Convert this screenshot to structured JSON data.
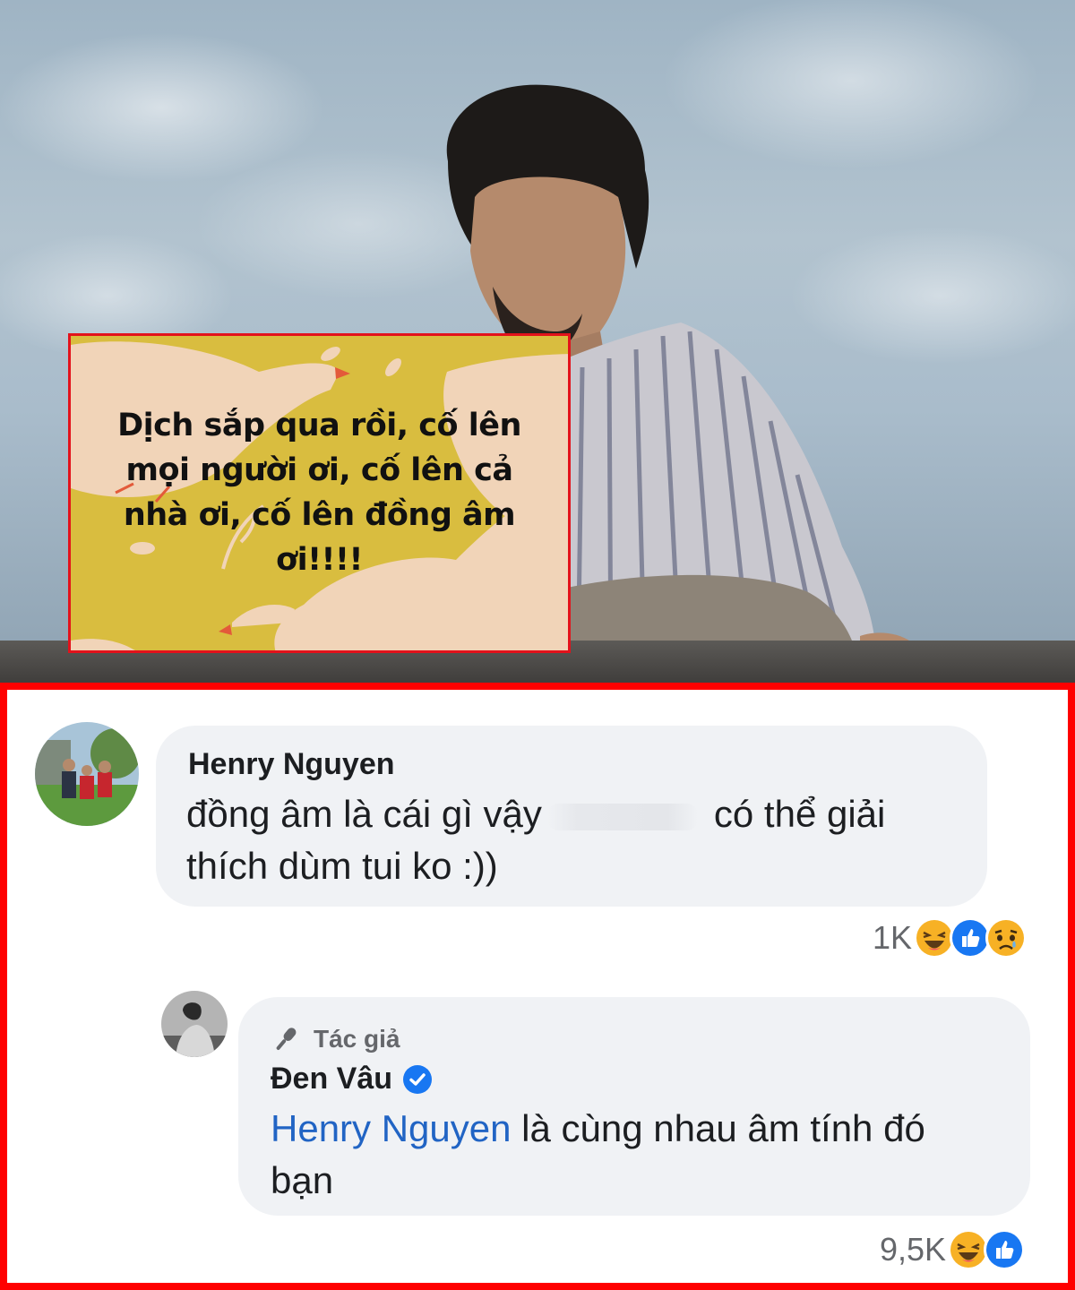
{
  "photo": {
    "quote_card": {
      "text_line1": "Dịch sắp qua rồi, cố lên",
      "text_line2": "mọi người ơi, cố lên cả",
      "text_line3": "nhà ơi, cố lên đồng âm",
      "text_line4": "ơi!!!!",
      "background_color": "#d9bd3f",
      "border_color": "#e3121b"
    }
  },
  "comments": {
    "border_color": "#ff0000",
    "items": [
      {
        "author": "Henry Nguyen",
        "text_part1": "đồng âm là cái gì vậy",
        "text_part2": "có thể giải",
        "text_line2": "thích dùm tui ko :))",
        "reaction_count": "1K",
        "reactions": [
          "haha-icon",
          "like-icon",
          "sad-icon"
        ]
      }
    ],
    "reply": {
      "badge_label": "Tác giả",
      "author": "Đen Vâu",
      "verified": true,
      "mention": "Henry Nguyen",
      "text_line1_rest": " là cùng nhau âm tính đó",
      "text_line2": "bạn",
      "reaction_count": "9,5K",
      "reactions": [
        "haha-icon",
        "like-icon"
      ]
    },
    "colors": {
      "bubble": "#f0f2f5",
      "mention": "#2164c4",
      "verified": "#1877f2",
      "like": "#1877f2",
      "haha": "#f7b125"
    }
  }
}
